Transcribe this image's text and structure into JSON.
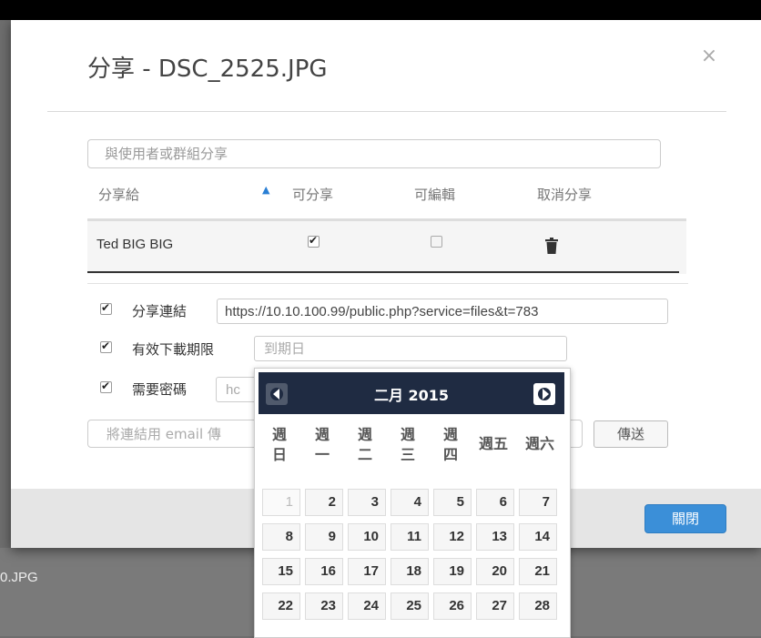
{
  "background": {
    "file_name": "0.JPG"
  },
  "modal": {
    "title": "分享 - DSC_2525.JPG",
    "close_symbol": "×",
    "share_placeholder": "與使用者或群組分享",
    "table": {
      "headers": {
        "shared_with": "分享給",
        "can_share": "可分享",
        "can_edit": "可編輯",
        "unshare": "取消分享"
      },
      "sort_indicator": "▲",
      "rows": [
        {
          "name": "Ted BIG BIG",
          "can_share": true,
          "can_edit": false
        }
      ]
    },
    "share_link": {
      "label": "分享連結",
      "checked": true,
      "value": "https://10.10.100.99/public.php?service=files&t=783"
    },
    "expiry": {
      "label": "有效下載期限",
      "checked": true,
      "placeholder": "到期日"
    },
    "password": {
      "label": "需要密碼",
      "checked": true,
      "placeholder": "hc"
    },
    "email": {
      "placeholder": "將連結用 email 傳",
      "send_label": "傳送"
    },
    "footer": {
      "close_label": "關閉"
    }
  },
  "calendar": {
    "month_title": "二月 2015",
    "weekdays": [
      "週\n日",
      "週\n一",
      "週\n二",
      "週\n三",
      "週\n四",
      "週五",
      "週六"
    ],
    "weeks": [
      [
        1,
        2,
        3,
        4,
        5,
        6,
        7
      ],
      [
        8,
        9,
        10,
        11,
        12,
        13,
        14
      ],
      [
        15,
        16,
        17,
        18,
        19,
        20,
        21
      ],
      [
        22,
        23,
        24,
        25,
        26,
        27,
        28
      ]
    ],
    "disabled_days": [
      1
    ]
  },
  "colors": {
    "accent": "#3b8fd8",
    "calendar_header": "#1f2b42"
  }
}
